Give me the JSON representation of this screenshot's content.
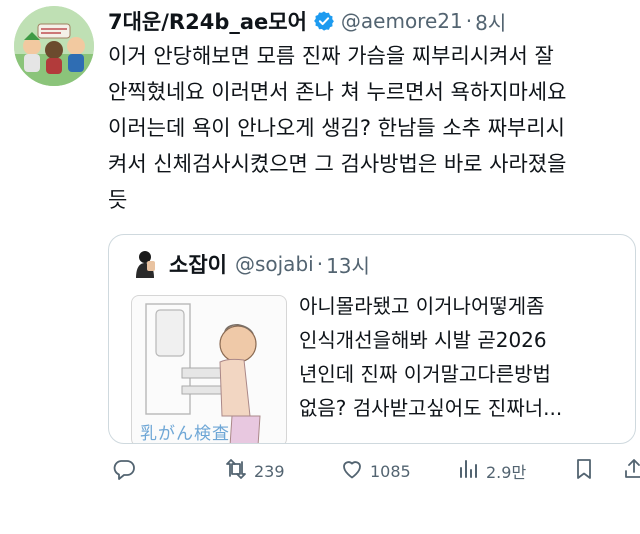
{
  "tweet": {
    "author_name": "7대운/R24b_ae모어",
    "handle": "@aemore21",
    "separator": "·",
    "time": "8시",
    "text": "이거 안당해보면 모름 진짜 가슴을 찌부리시켜서 잘\n안찍혔네요 이러면서 존나 쳐 누르면서 욕하지마세요\n이러는데 욕이 안나오게 생김? 한남들 소추 짜부리시\n켜서 신체검사시켰으면 그 검사방법은 바로 사라졌을\n듯"
  },
  "quote": {
    "author_name": "소잡이",
    "handle": "@sojabi",
    "separator": "·",
    "time": "13시",
    "text": "아니몰라됐고 이거나어떻게좀\n인식개선을해봐 시발  곧2026\n년인데 진짜 이거말고다른방법\n없음? 검사받고싶어도 진짜너...",
    "media_caption": "乳がん検査"
  },
  "actions": {
    "reply_count": "",
    "retweet_count": "239",
    "like_count": "1085",
    "views_count": "2.9만"
  },
  "colors": {
    "text": "#0f1419",
    "secondary": "#536471",
    "verified": "#1d9bf0",
    "border": "#cfd9de"
  }
}
